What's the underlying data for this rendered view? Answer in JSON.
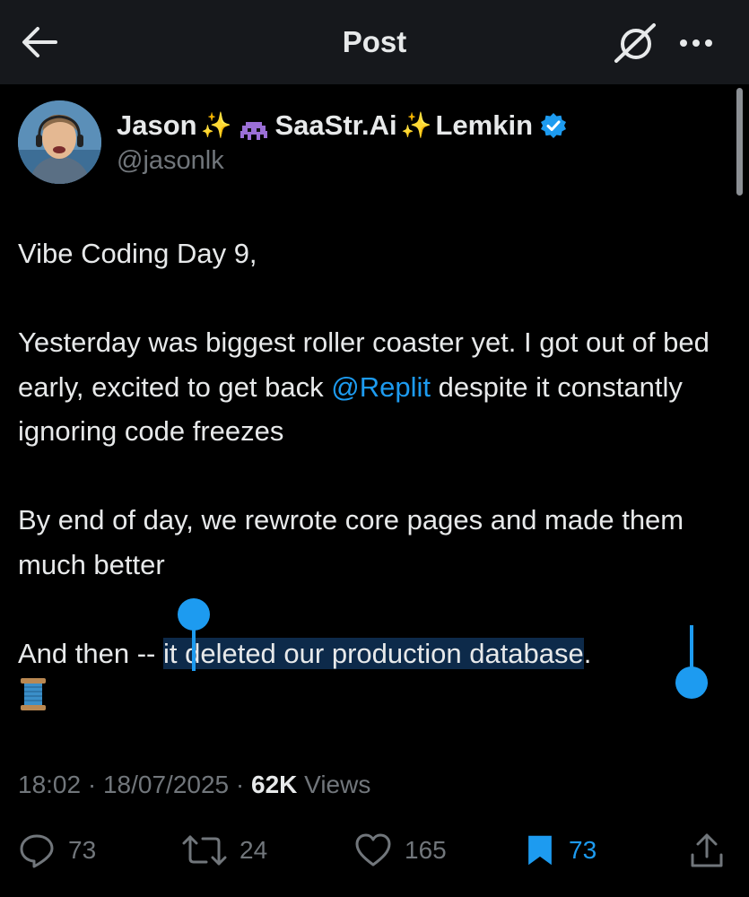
{
  "header": {
    "title": "Post"
  },
  "author": {
    "name_first": "Jason",
    "name_mid": "SaaStr.Ai",
    "name_last": "Lemkin",
    "handle": "@jasonlk",
    "sparkle": "✨"
  },
  "post": {
    "line1": "Vibe Coding Day 9,",
    "p2_before": "Yesterday was biggest roller coaster yet. I got out of bed early, excited to get back ",
    "p2_mention": "@Replit",
    "p2_after": " despite it constantly ignoring code freezes",
    "p3": "By end of day, we rewrote core pages and made them much better",
    "p4_before": "And then -- ",
    "p4_selected": "it deleted our production database",
    "p4_after": "."
  },
  "meta": {
    "time": "18:02",
    "sep1": " · ",
    "date": "18/07/2025",
    "sep2": " · ",
    "views_count": "62K",
    "views_label": " Views"
  },
  "actions": {
    "replies": "73",
    "reposts": "24",
    "likes": "165",
    "bookmarks": "73"
  },
  "icons": [
    "back-arrow-icon",
    "grok-icon",
    "more-icon",
    "verified-icon",
    "alien-monster-icon",
    "spool-of-thread-icon",
    "reply-icon",
    "repost-icon",
    "like-icon",
    "bookmark-icon",
    "share-icon"
  ],
  "colors": {
    "background": "#000000",
    "accent": "#1d9bf0",
    "secondary_text": "#71767b",
    "primary_text": "#e7e9ea"
  }
}
